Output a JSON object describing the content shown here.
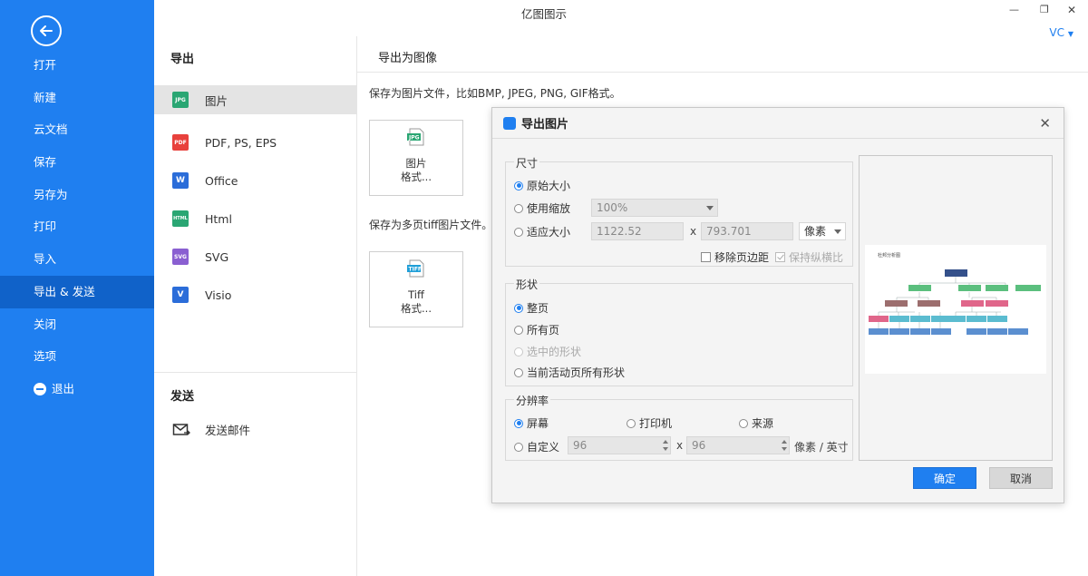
{
  "app": {
    "title": "亿图图示",
    "user": "VC"
  },
  "sidebar": {
    "items": [
      {
        "label": "打开"
      },
      {
        "label": "新建"
      },
      {
        "label": "云文档"
      },
      {
        "label": "保存"
      },
      {
        "label": "另存为"
      },
      {
        "label": "打印"
      },
      {
        "label": "导入"
      },
      {
        "label": "导出 & 发送",
        "active": true
      },
      {
        "label": "关闭"
      },
      {
        "label": "选项"
      },
      {
        "label": "退出"
      }
    ]
  },
  "export_panel": {
    "heading": "导出",
    "items": [
      {
        "label": "图片",
        "icon": "JPG",
        "color": "#2aa673"
      },
      {
        "label": "PDF, PS, EPS",
        "icon": "PDF",
        "color": "#e8413c"
      },
      {
        "label": "Office",
        "icon": "W",
        "color": "#2b6dd9"
      },
      {
        "label": "Html",
        "icon": "HTML",
        "color": "#2aa673"
      },
      {
        "label": "SVG",
        "icon": "SVG",
        "color": "#8a5fd1"
      },
      {
        "label": "Visio",
        "icon": "V",
        "color": "#2b6dd9"
      }
    ],
    "send_heading": "发送",
    "send_mail": "发送邮件"
  },
  "content": {
    "title": "导出为图像",
    "desc_image": "保存为图片文件，比如BMP, JPEG, PNG, GIF格式。",
    "btn_image_line1": "图片",
    "btn_image_line2": "格式...",
    "desc_tiff": "保存为多页tiff图片文件。",
    "btn_tiff_line1": "Tiff",
    "btn_tiff_line2": "格式..."
  },
  "dialog": {
    "title": "导出图片",
    "size": {
      "label": "尺寸",
      "original": "原始大小",
      "use_zoom": "使用缩放",
      "zoom_value": "100%",
      "fit_size": "适应大小",
      "width": "1122.52",
      "x": "x",
      "height": "793.701",
      "unit": "像素",
      "remove_margin": "移除页边距",
      "keep_ratio": "保持纵横比"
    },
    "shape": {
      "label": "形状",
      "whole_page": "整页",
      "all_pages": "所有页",
      "selected": "选中的形状",
      "current_all": "当前活动页所有形状"
    },
    "resolution": {
      "label": "分辨率",
      "screen": "屏幕",
      "printer": "打印机",
      "source": "来源",
      "custom": "自定义",
      "w": "96",
      "x": "x",
      "h": "96",
      "unit": "像素 / 英寸"
    },
    "preview_title": "杜邦分析图",
    "ok": "确定",
    "cancel": "取消"
  },
  "colors": {
    "accent": "#1f7ff0",
    "sidebar_active": "#1062c9"
  }
}
